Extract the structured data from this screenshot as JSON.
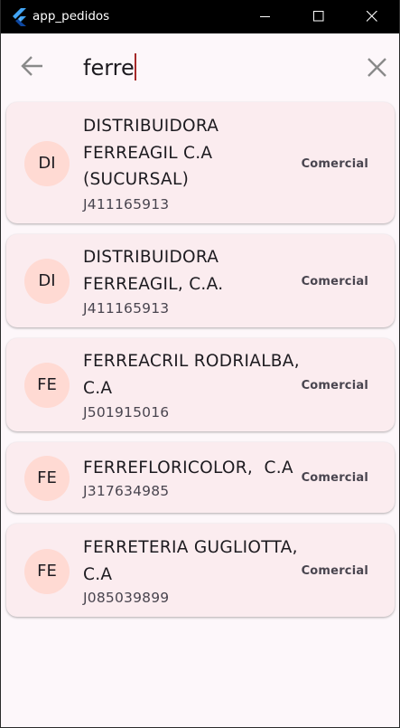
{
  "window": {
    "title": "app_pedidos"
  },
  "search": {
    "query": "ferre"
  },
  "results": [
    {
      "initials": "DI",
      "name": "DISTRIBUIDORA FERREAGIL C.A (SUCURSAL)",
      "rif": "J411165913",
      "type": "Comercial"
    },
    {
      "initials": "DI",
      "name": "DISTRIBUIDORA FERREAGIL, C.A.",
      "rif": "J411165913",
      "type": "Comercial"
    },
    {
      "initials": "FE",
      "name": "FERREACRIL RODRIALBA, C.A",
      "rif": "J501915016",
      "type": "Comercial"
    },
    {
      "initials": "FE",
      "name": "FERREFLORICOLOR,  C.A",
      "rif": "J317634985",
      "type": "Comercial"
    },
    {
      "initials": "FE",
      "name": "FERRETERIA GUGLIOTTA, C.A",
      "rif": "J085039899",
      "type": "Comercial"
    }
  ],
  "colors": {
    "titlebar": "#000000",
    "background": "#fdf7fa",
    "card": "#fbecef",
    "avatar": "#ffdad3",
    "caret": "#a52a2a"
  },
  "icons": {
    "app": "flutter-logo-icon",
    "back": "arrow-back-icon",
    "clear": "close-icon",
    "minimize": "minimize-icon",
    "maximize": "maximize-icon",
    "close": "window-close-icon"
  }
}
